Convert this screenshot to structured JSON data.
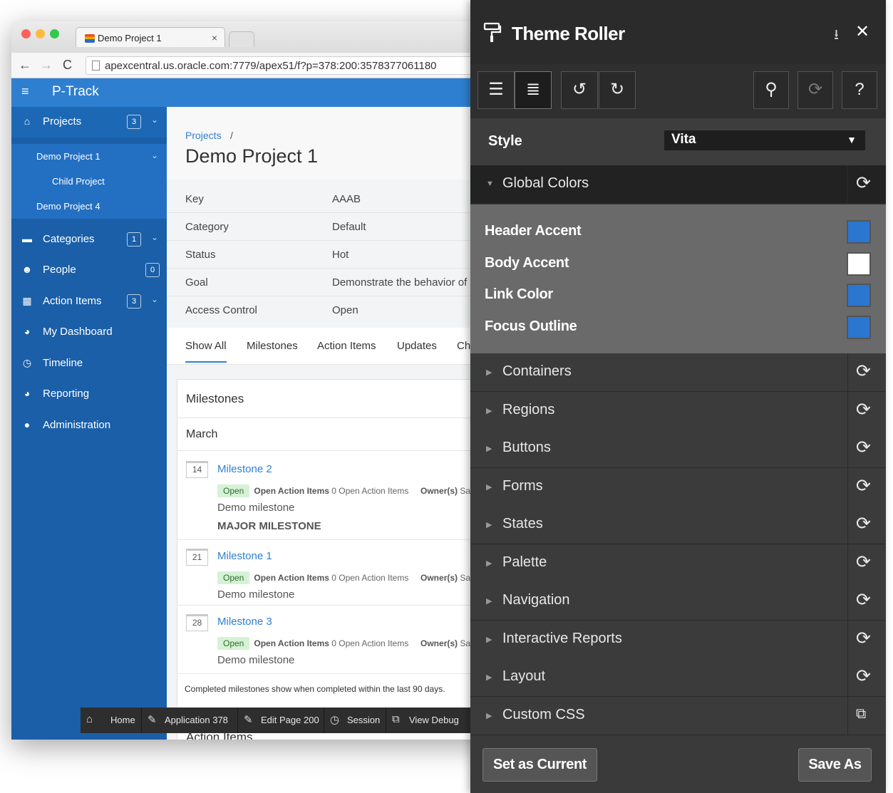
{
  "browser": {
    "tab_title": "Demo Project 1",
    "tab_close": "×",
    "url": "apexcentral.us.oracle.com:7779/apex51/f?p=378:200:3578377061180"
  },
  "app": {
    "name": "P-Track",
    "menu_icon": "≡"
  },
  "sidebar": {
    "items": [
      {
        "label": "Projects",
        "badge": "3",
        "icon": "home-icon",
        "glyph": "⌂"
      },
      {
        "label": "Categories",
        "badge": "1",
        "icon": "folder-icon",
        "glyph": "▬"
      },
      {
        "label": "People",
        "badge": "0",
        "icon": "users-icon",
        "glyph": "☻"
      },
      {
        "label": "Action Items",
        "badge": "3",
        "icon": "calendar-icon",
        "glyph": "▦"
      },
      {
        "label": "My Dashboard",
        "icon": "dashboard-icon",
        "glyph": "◕"
      },
      {
        "label": "Timeline",
        "icon": "clock-icon",
        "glyph": "◷"
      },
      {
        "label": "Reporting",
        "icon": "dashboard-icon",
        "glyph": "◕"
      },
      {
        "label": "Administration",
        "icon": "user-icon",
        "glyph": "●"
      }
    ],
    "subitems": [
      {
        "label": "Demo Project 1"
      },
      {
        "label": "Child Project"
      },
      {
        "label": "Demo Project 4"
      }
    ]
  },
  "page": {
    "breadcrumb": "Projects",
    "breadcrumb_sep": "/",
    "title": "Demo Project 1",
    "details": [
      {
        "key": "Key",
        "value": "AAAB"
      },
      {
        "key": "Category",
        "value": "Default"
      },
      {
        "key": "Status",
        "value": "Hot"
      },
      {
        "key": "Goal",
        "value": "Demonstrate the behavior of"
      },
      {
        "key": "Access Control",
        "value": "Open"
      }
    ],
    "tabs": [
      "Show All",
      "Milestones",
      "Action Items",
      "Updates",
      "Ch"
    ]
  },
  "milestones": {
    "heading": "Milestones",
    "month": "March",
    "items": [
      {
        "day": "14",
        "name": "Milestone 2",
        "status": "Open",
        "oai_label": "Open Action Items",
        "oai_value": "0 Open Action Items",
        "owner_label": "Owner(s)",
        "owner_value": "Sa",
        "desc": "Demo milestone",
        "tag": "MAJOR MILESTONE"
      },
      {
        "day": "21",
        "name": "Milestone 1",
        "status": "Open",
        "oai_label": "Open Action Items",
        "oai_value": "0 Open Action Items",
        "owner_label": "Owner(s)",
        "owner_value": "Sa",
        "desc": "Demo milestone"
      },
      {
        "day": "28",
        "name": "Milestone 3",
        "status": "Open",
        "oai_label": "Open Action Items",
        "oai_value": "0 Open Action Items",
        "owner_label": "Owner(s)",
        "owner_value": "Sa",
        "desc": "Demo milestone"
      }
    ],
    "footer": "Completed milestones show when completed within the last 90 days.",
    "next_region_heading": "Action Items"
  },
  "devbar": {
    "items": [
      {
        "label": "Home",
        "icon": "home-icon",
        "glyph": "⌂"
      },
      {
        "label": "Application 378",
        "icon": "edit-icon",
        "glyph": "✎"
      },
      {
        "label": "Edit Page 200",
        "icon": "edit-icon",
        "glyph": "✎"
      },
      {
        "label": "Session",
        "icon": "clock-icon",
        "glyph": "◷"
      },
      {
        "label": "View Debug",
        "icon": "debug-icon",
        "glyph": "⧉"
      }
    ]
  },
  "roller": {
    "title": "Theme Roller",
    "style_label": "Style",
    "style_value": "Vita",
    "global_group": "Global Colors",
    "colors": [
      {
        "label": "Header Accent",
        "color": "#2a76d0"
      },
      {
        "label": "Body Accent",
        "color": "#ffffff"
      },
      {
        "label": "Link Color",
        "color": "#2a76d0"
      },
      {
        "label": "Focus Outline",
        "color": "#2a76d0"
      }
    ],
    "groups": [
      "Containers",
      "Regions",
      "Buttons",
      "Forms",
      "States",
      "Palette",
      "Navigation",
      "Interactive Reports",
      "Layout",
      "Custom CSS"
    ],
    "set_current": "Set as Current",
    "save_as": "Save As"
  },
  "colors": {
    "header": "#2f7fd0",
    "sidebar": "#1a5fa8",
    "panel": "#3a3a3a"
  }
}
